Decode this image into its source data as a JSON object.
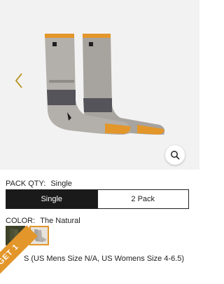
{
  "gallery": {
    "product_image": "socks-product-image",
    "prev_icon": "chevron-left-icon",
    "zoom_icon": "magnifier-icon"
  },
  "pack_qty": {
    "label": "PACK QTY:",
    "selected": "Single",
    "options": [
      "Single",
      "2 Pack"
    ]
  },
  "color": {
    "label": "COLOR:",
    "selected": "The Natural",
    "swatches": [
      "olive-swatch",
      "natural-swatch"
    ]
  },
  "size": {
    "text_visible": "S (US Mens Size N/A, US Womens Size 4-6.5)"
  },
  "promo": {
    "label": "GET 1"
  },
  "colors": {
    "accent": "#e3962a",
    "dark": "#1a1a1a",
    "sock_gray": "#a7a39e"
  }
}
